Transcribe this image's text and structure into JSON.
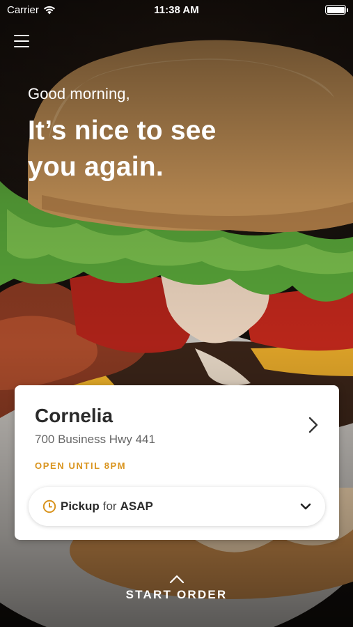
{
  "status_bar": {
    "carrier": "Carrier",
    "time": "11:38 AM",
    "battery_level": 1.0
  },
  "header": {
    "menu_icon": "hamburger-menu-icon"
  },
  "greeting": {
    "salutation": "Good morning,",
    "headline": "It’s nice to see you again."
  },
  "location_card": {
    "store_name": "Cornelia",
    "address": "700 Business Hwy 441",
    "hours": "OPEN UNTIL 8PM",
    "chevron_icon": "chevron-right-icon",
    "pickup": {
      "icon": "clock-icon",
      "mode": "Pickup",
      "connector": "for",
      "time": "ASAP",
      "dropdown_icon": "chevron-down-icon"
    }
  },
  "footer": {
    "start_order_label": "START ORDER",
    "caret_icon": "caret-up-icon"
  },
  "colors": {
    "accent": "#D9941E",
    "card_background": "#FFFFFF",
    "text_dark": "#2A2A2A",
    "text_muted": "#666666"
  }
}
